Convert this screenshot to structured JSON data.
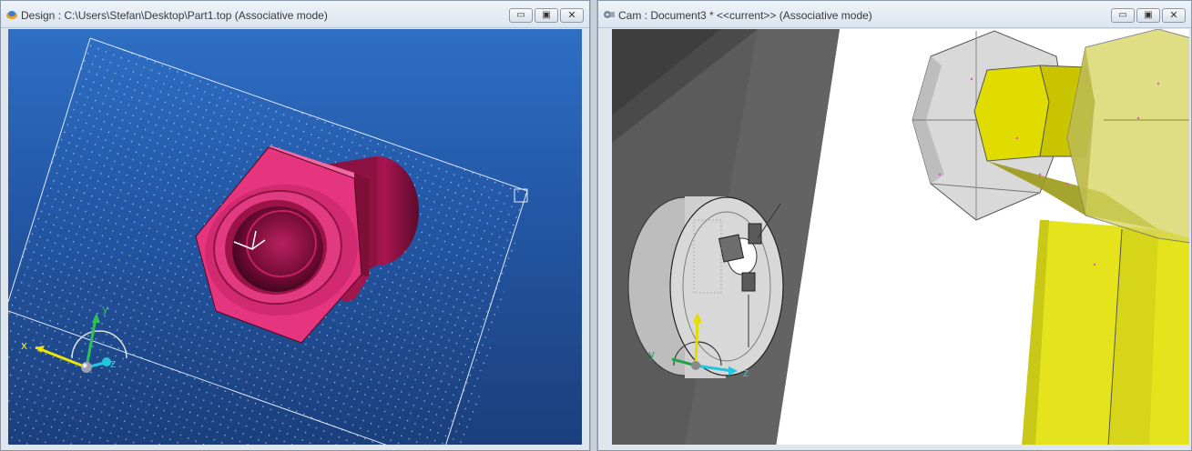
{
  "design_window": {
    "title": "Design : C:\\Users\\Stefan\\Desktop\\Part1.top (Associative mode)",
    "icon": "design-app-icon",
    "buttons": {
      "minimize": "▭",
      "restore": "▣",
      "close": "✕"
    },
    "axes": {
      "x": "x",
      "y": "y",
      "z": "z"
    },
    "colors": {
      "background": "#2459a8",
      "part": "#e6357f",
      "grid": "#ffffff"
    }
  },
  "cam_window": {
    "title": "Cam : Document3 *  <<current>> (Associative mode)",
    "icon": "cam-app-icon",
    "buttons": {
      "minimize": "▭",
      "restore": "▣",
      "close": "✕"
    },
    "axes": {
      "x": "",
      "y": "y",
      "z": "z"
    },
    "colors": {
      "background": "#ffffff",
      "tool": "#e4e31c",
      "chuck": "#d3d3d3",
      "wall": "#5b5b5b"
    }
  }
}
